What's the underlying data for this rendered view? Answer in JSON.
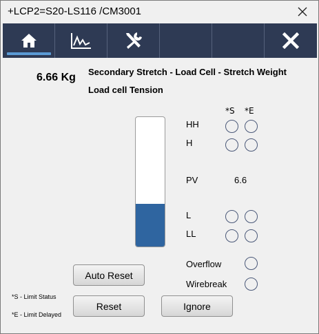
{
  "window": {
    "title": "+LCP2=S20-LS116 /CM3001",
    "close_icon": "close-x"
  },
  "toolbar": {
    "buttons": [
      {
        "icon": "home-icon",
        "active": true
      },
      {
        "icon": "trend-chart-icon",
        "active": false
      },
      {
        "icon": "tools-icon",
        "active": false
      },
      {
        "icon": "empty",
        "active": false
      },
      {
        "icon": "empty",
        "active": false
      },
      {
        "icon": "close-icon",
        "active": false
      }
    ],
    "colors": {
      "background": "#2e3a54",
      "active_underline": "#5b9bd5"
    }
  },
  "reading": {
    "value": "6.66 Kg",
    "description": "Secondary Stretch - Load Cell - Stretch Weight",
    "subtitle": "Load cell Tension"
  },
  "bar": {
    "fill_fraction": 0.33,
    "fill_color": "#2f65a0"
  },
  "limits": {
    "header_s": "*S",
    "header_e": "*E",
    "hh_label": "HH",
    "h_label": "H",
    "pv_label": "PV",
    "pv_value": "6.6",
    "l_label": "L",
    "ll_label": "LL",
    "overflow_label": "Overflow",
    "wirebreak_label": "Wirebreak"
  },
  "buttons": {
    "auto_reset": "Auto Reset",
    "reset": "Reset",
    "ignore": "Ignore"
  },
  "footnotes": {
    "s_note": "*S - Limit Status",
    "e_note": "*E - Limit Delayed"
  }
}
